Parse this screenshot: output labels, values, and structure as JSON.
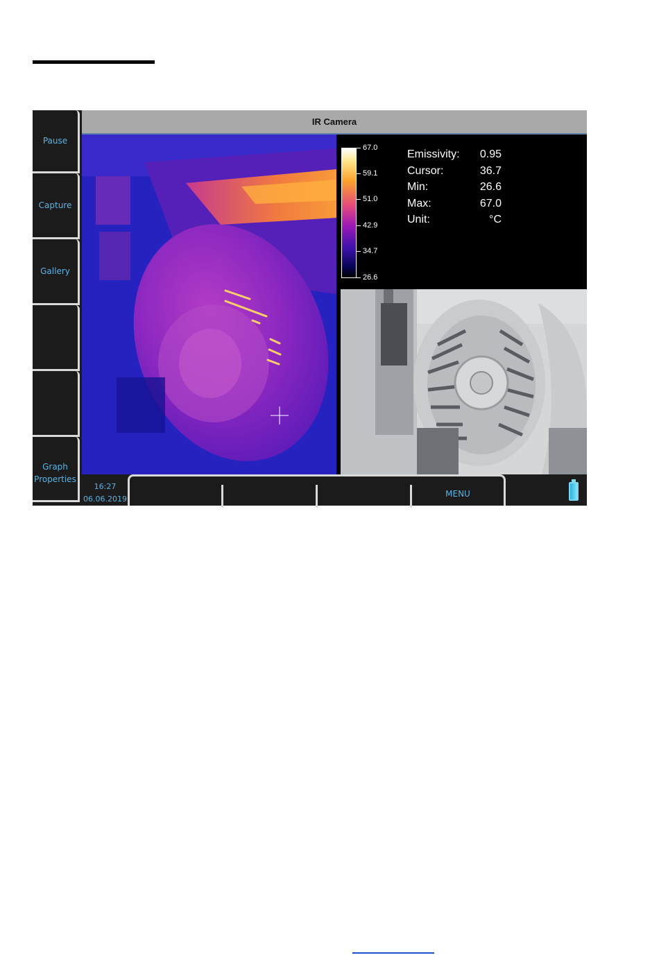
{
  "window": {
    "title": "IR Camera"
  },
  "softkeys": [
    {
      "label": "Pause"
    },
    {
      "label": "Capture"
    },
    {
      "label": "Gallery"
    },
    {
      "label": ""
    },
    {
      "label": ""
    },
    {
      "label": "Graph\nProperties"
    }
  ],
  "colorscale": {
    "ticks": [
      "67.0",
      "59.1",
      "51.0",
      "42.9",
      "34.7",
      "26.6"
    ]
  },
  "info": {
    "emissivity": {
      "label": "Emissivity:",
      "value": "0.95"
    },
    "cursor": {
      "label": "Cursor:",
      "value": "36.7"
    },
    "min": {
      "label": "Min:",
      "value": "26.6"
    },
    "max": {
      "label": "Max:",
      "value": "67.0"
    },
    "unit": {
      "label": "Unit:",
      "value": "°C"
    }
  },
  "statusbar": {
    "time": "16:27",
    "date": "06.06.2019",
    "menu_label": "MENU",
    "battery_icon": "battery-icon"
  },
  "colors": {
    "accent": "#5ab4e6",
    "titlebar": "#a9a9a9",
    "panel": "#1b1b1b"
  }
}
